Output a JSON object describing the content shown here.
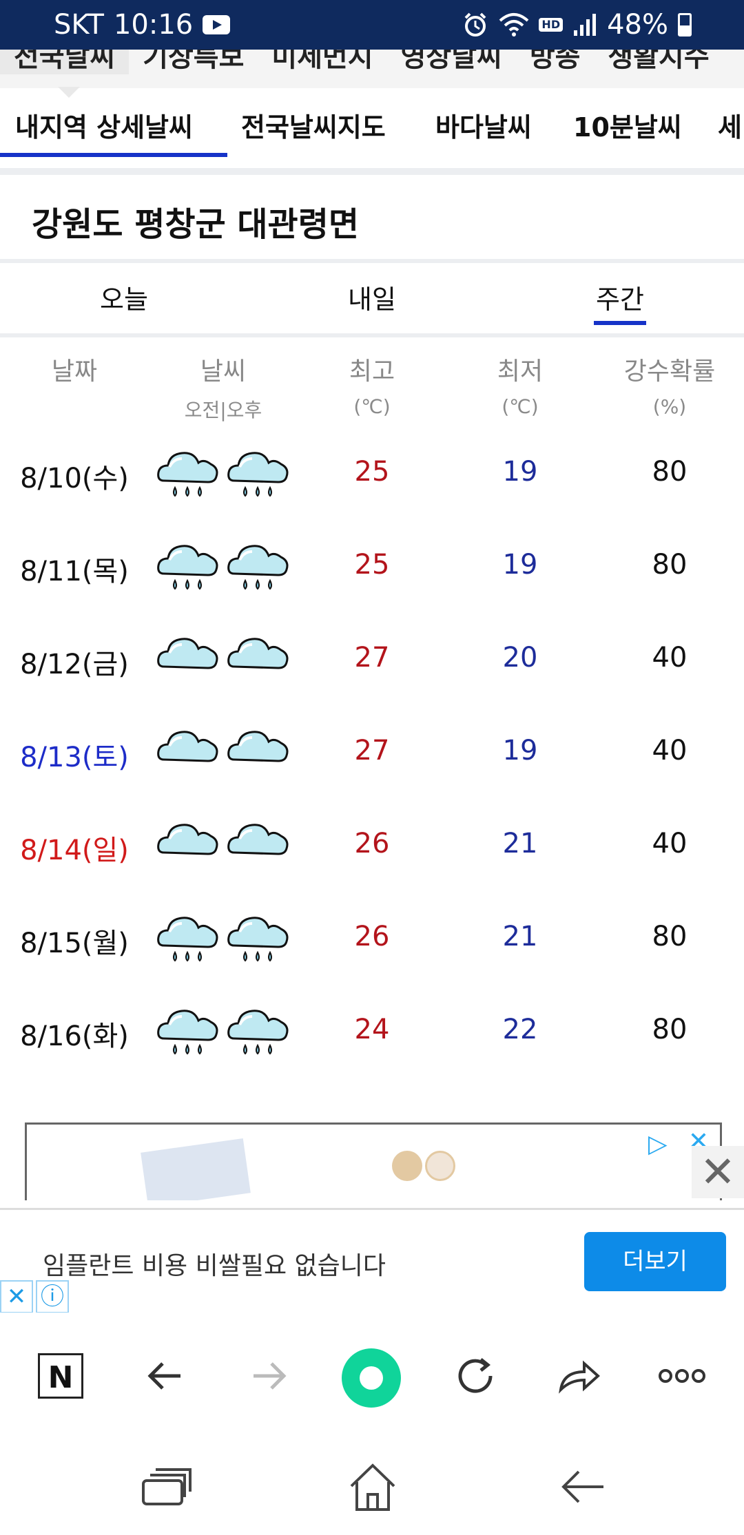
{
  "status_bar": {
    "carrier": "SKT",
    "time": "10:16",
    "hd_label": "HD",
    "battery_percent": "48%",
    "battery_level": 0.48
  },
  "top_tabs": [
    "전국날씨",
    "기상특보",
    "미세먼지",
    "영상날씨",
    "방송",
    "생활지수"
  ],
  "sub_tabs": [
    "내지역 상세날씨",
    "전국날씨지도",
    "바다날씨",
    "10분날씨",
    "세"
  ],
  "location": "강원도 평창군 대관령면",
  "period_tabs": [
    "오늘",
    "내일",
    "주간"
  ],
  "table": {
    "headers": {
      "date": "날짜",
      "weather": "날씨",
      "weather_sub": "오전|오후",
      "high": "최고",
      "high_unit": "(℃)",
      "low": "최저",
      "low_unit": "(℃)",
      "precip": "강수확률",
      "precip_unit": "(%)"
    },
    "rows": [
      {
        "date": "8/10(수)",
        "am": "rain-cloud-icon",
        "pm": "rain-cloud-icon",
        "high": "25",
        "low": "19",
        "pop": "80",
        "date_color": "#111111"
      },
      {
        "date": "8/11(목)",
        "am": "rain-cloud-icon",
        "pm": "rain-cloud-icon",
        "high": "25",
        "low": "19",
        "pop": "80",
        "date_color": "#111111"
      },
      {
        "date": "8/12(금)",
        "am": "cloud-icon",
        "pm": "cloud-icon",
        "high": "27",
        "low": "20",
        "pop": "40",
        "date_color": "#111111"
      },
      {
        "date": "8/13(토)",
        "am": "cloud-icon",
        "pm": "cloud-icon",
        "high": "27",
        "low": "19",
        "pop": "40",
        "date_color": "#1d2cc8"
      },
      {
        "date": "8/14(일)",
        "am": "cloud-icon",
        "pm": "cloud-icon",
        "high": "26",
        "low": "21",
        "pop": "40",
        "date_color": "#d11a1a"
      },
      {
        "date": "8/15(월)",
        "am": "rain-cloud-icon",
        "pm": "rain-cloud-icon",
        "high": "26",
        "low": "21",
        "pop": "80",
        "date_color": "#111111"
      },
      {
        "date": "8/16(화)",
        "am": "rain-cloud-icon",
        "pm": "rain-cloud-icon",
        "high": "24",
        "low": "22",
        "pop": "80",
        "date_color": "#111111"
      }
    ]
  },
  "ad": {
    "text": "임플란트 비용 비쌀필요 없습니다",
    "button": "더보기"
  },
  "colors": {
    "status_bar": "#0f2a5e",
    "accent_blue": "#1633c8",
    "high_temp": "#b3141b",
    "low_temp": "#1d2c9a",
    "ad_button": "#0d8be8",
    "browser_green": "#10d49a"
  }
}
